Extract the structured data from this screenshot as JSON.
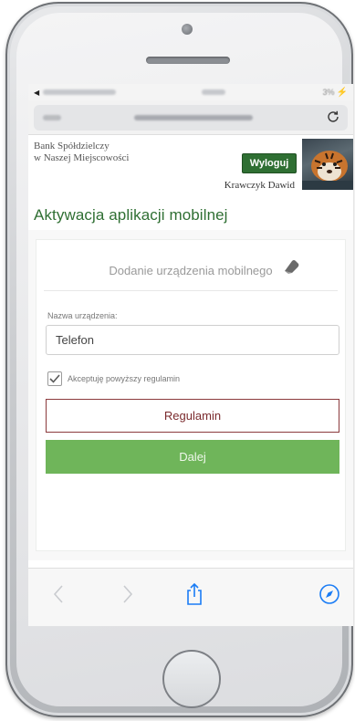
{
  "status_bar": {
    "battery": "3%"
  },
  "bank": {
    "name_line1": "Bank Spółdzielczy",
    "name_line2": "w Naszej Miejscowości",
    "logout_label": "Wyloguj",
    "user_name": "Krawczyk Dawid"
  },
  "page": {
    "title": "Aktywacja aplikacji mobilnej"
  },
  "form": {
    "section_title": "Dodanie urządzenia mobilnego",
    "device_name_label": "Nazwa urządzenia:",
    "device_name_value": "Telefon",
    "accept_terms_label": "Akceptuję powyższy regulamin",
    "accept_terms_checked": true,
    "terms_button": "Regulamin",
    "next_button": "Dalej"
  },
  "colors": {
    "brand_green": "#2f6f33",
    "terms_border": "#8b3a3c",
    "next_green": "#6fb55a",
    "ios_blue": "#1a7cf5"
  },
  "icons": [
    "reload-icon",
    "eraser-icon",
    "checkmark-icon",
    "back-arrow-icon",
    "forward-arrow-icon",
    "share-icon",
    "compass-icon"
  ]
}
